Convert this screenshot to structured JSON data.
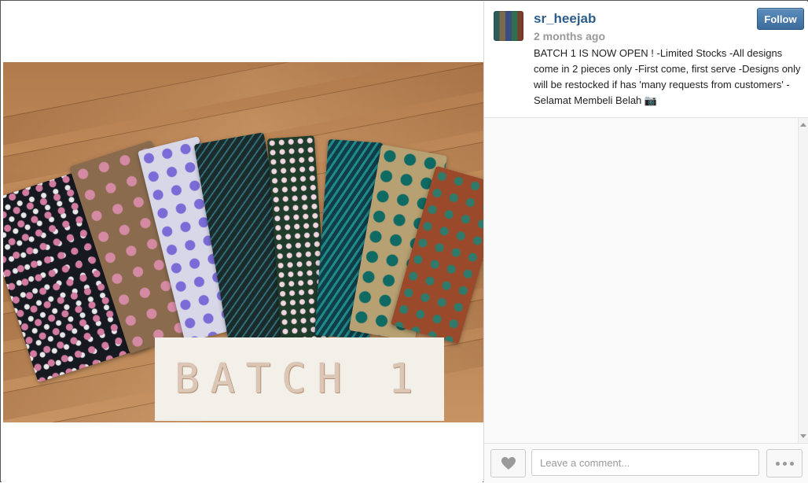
{
  "post": {
    "username": "sr_heejab",
    "time_ago": "2 months ago",
    "caption": "BATCH 1 IS NOW OPEN ! -Limited Stocks -All designs come in 2 pieces only -First come, first serve -Designs only will be restocked if has 'many requests from customers' -Selamat Membeli Belah 📷",
    "photo_text": "BATCH 1"
  },
  "actions": {
    "follow_label": "Follow",
    "comment_placeholder": "Leave a comment..."
  },
  "icons": {
    "like": "heart-icon",
    "more": "more-dots-icon"
  },
  "colors": {
    "username": "#2c5d8a",
    "follow_button": "#4a7aab"
  }
}
